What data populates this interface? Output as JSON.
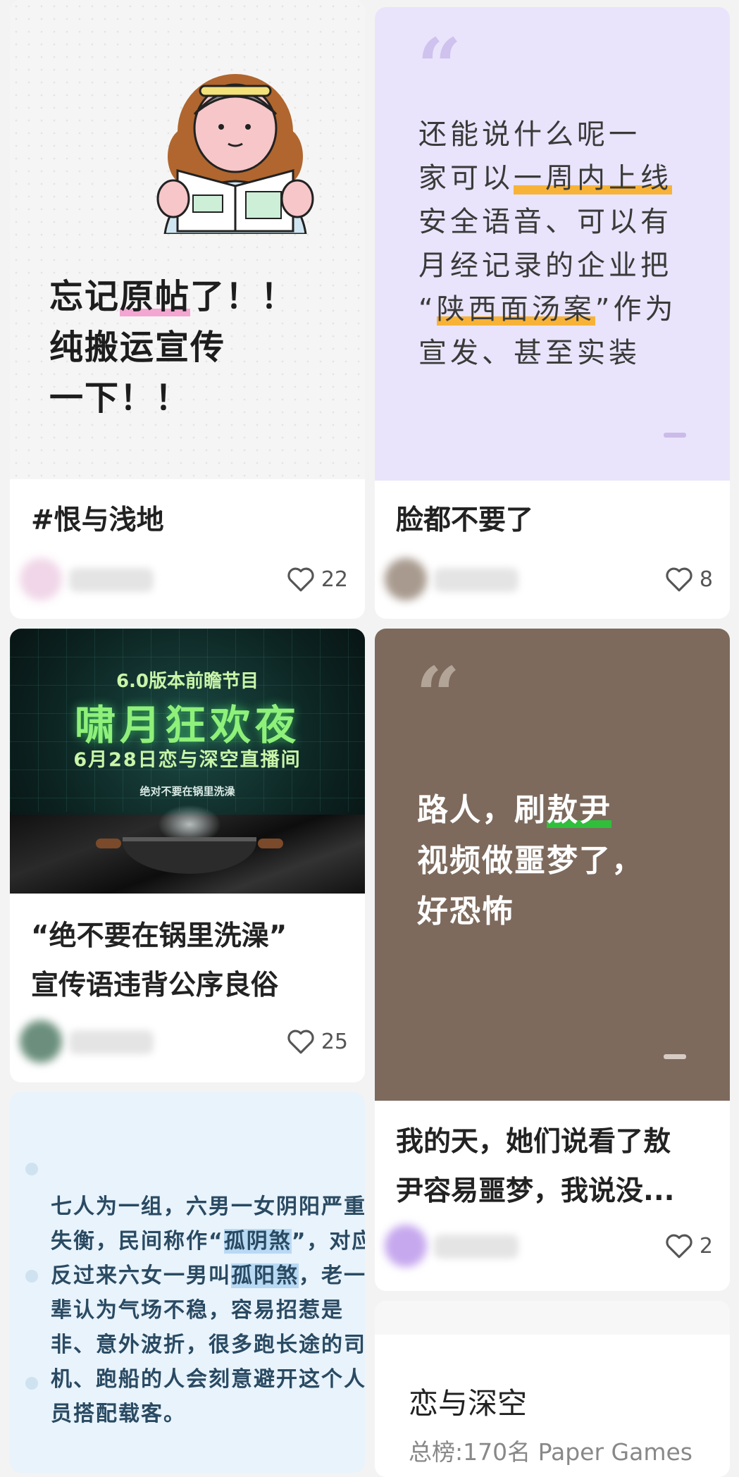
{
  "feed": {
    "cards": [
      {
        "cover_text": [
          "忘记",
          "原帖",
          "了！！",
          "纯搬运宣传",
          "一下！！"
        ],
        "title": "#恨与浅地",
        "likes": "22"
      },
      {
        "quote_lines": [
          "还能说什么呢一",
          "家可以",
          "一周内上线",
          "安全语音、可以有",
          "月经记录的企业把",
          "“",
          "陕西面汤案",
          "”作为",
          "宣发、甚至实装"
        ],
        "title": "脸都不要了",
        "likes": "8"
      },
      {
        "cover_subtitle": "6.0版本前瞻节目",
        "cover_title": "啸月狂欢夜",
        "cover_date": "6月28日恋与深空直播间",
        "cover_caption": "绝对不要在锅里洗澡",
        "title_lines": [
          "“绝不要在锅里洗澡”",
          "宣传语违背公序良俗"
        ],
        "likes": "25"
      },
      {
        "quote_lines": [
          "路人，刷",
          "敖尹",
          "视频做噩梦了，",
          "好恐怖"
        ],
        "title_lines": [
          "我的天，她们说看了敖",
          "尹容易噩梦，我说没..."
        ],
        "likes": "2"
      },
      {
        "text_parts": [
          "七人为一组，六男一女阴阳严重失衡，民间称作“",
          "孤阴煞",
          "”，对应反过来六女一男叫",
          "孤阳煞",
          "，老一辈认为气场不稳，容易招惹是非、意外波折，很多跑长途的司机、跑船的人会刻意避开这个人员搭配载客。"
        ]
      },
      {
        "title": "恋与深空",
        "subtitle": "总榜:170名  Paper Games"
      }
    ]
  },
  "icons": {
    "like": "heart-outline-icon",
    "quote": "quote-mark-icon"
  },
  "colors": {
    "purple_bg": "#e9e4fb",
    "brown_bg": "#7d6a5d",
    "blue_bg": "#e8f3fc",
    "highlight_orange": "#f7b338",
    "highlight_green": "#2fbf3a",
    "highlight_blue": "#b8d9f4"
  }
}
